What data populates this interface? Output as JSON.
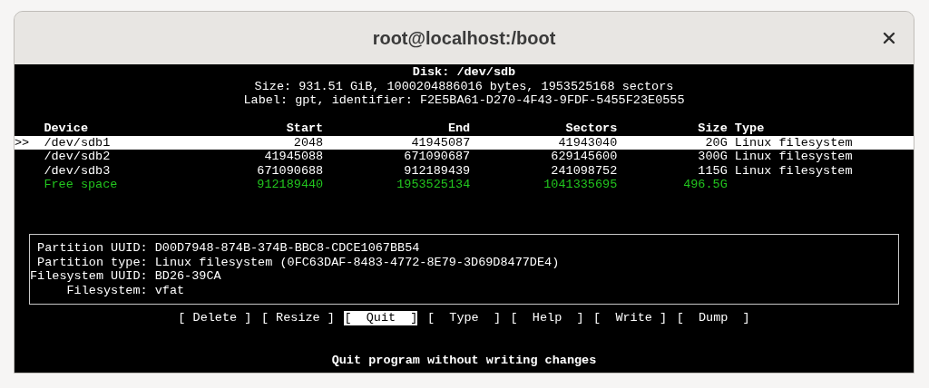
{
  "window": {
    "title": "root@localhost:/boot"
  },
  "disk": {
    "title": "Disk: /dev/sdb",
    "size_line": "Size: 931.51 GiB, 1000204886016 bytes, 1953525168 sectors",
    "label_line": "Label: gpt, identifier: F2E5BA61-D270-4F43-9FDF-5455F23E0555"
  },
  "table": {
    "cursor": ">>",
    "columns": [
      "Device",
      "Start",
      "End",
      "Sectors",
      "Size",
      "Type"
    ],
    "rows": [
      {
        "kind": "partition",
        "selected": true,
        "cells": [
          "/dev/sdb1",
          "2048",
          "41945087",
          "41943040",
          "20G",
          "Linux filesystem"
        ]
      },
      {
        "kind": "partition",
        "selected": false,
        "cells": [
          "/dev/sdb2",
          "41945088",
          "671090687",
          "629145600",
          "300G",
          "Linux filesystem"
        ]
      },
      {
        "kind": "partition",
        "selected": false,
        "cells": [
          "/dev/sdb3",
          "671090688",
          "912189439",
          "241098752",
          "115G",
          "Linux filesystem"
        ]
      },
      {
        "kind": "free",
        "selected": false,
        "cells": [
          "Free space",
          "912189440",
          "1953525134",
          "1041335695",
          "496.5G",
          ""
        ]
      }
    ]
  },
  "info": [
    {
      "label": "Partition UUID:",
      "value": "D00D7948-874B-374B-BBC8-CDCE1067BB54"
    },
    {
      "label": "Partition type:",
      "value": "Linux filesystem (0FC63DAF-8483-4772-8E79-3D69D8477DE4)"
    },
    {
      "label": "Filesystem UUID:",
      "value": "BD26-39CA"
    },
    {
      "label": "Filesystem:",
      "value": "vfat"
    }
  ],
  "menu": [
    {
      "label": "[ Delete ]",
      "selected": false
    },
    {
      "label": "[ Resize ]",
      "selected": false
    },
    {
      "label": "[  Quit  ]",
      "selected": true
    },
    {
      "label": "[  Type  ]",
      "selected": false
    },
    {
      "label": "[  Help  ]",
      "selected": false
    },
    {
      "label": "[  Write ]",
      "selected": false
    },
    {
      "label": "[  Dump  ]",
      "selected": false
    }
  ],
  "status_bar": "Quit program without writing changes"
}
